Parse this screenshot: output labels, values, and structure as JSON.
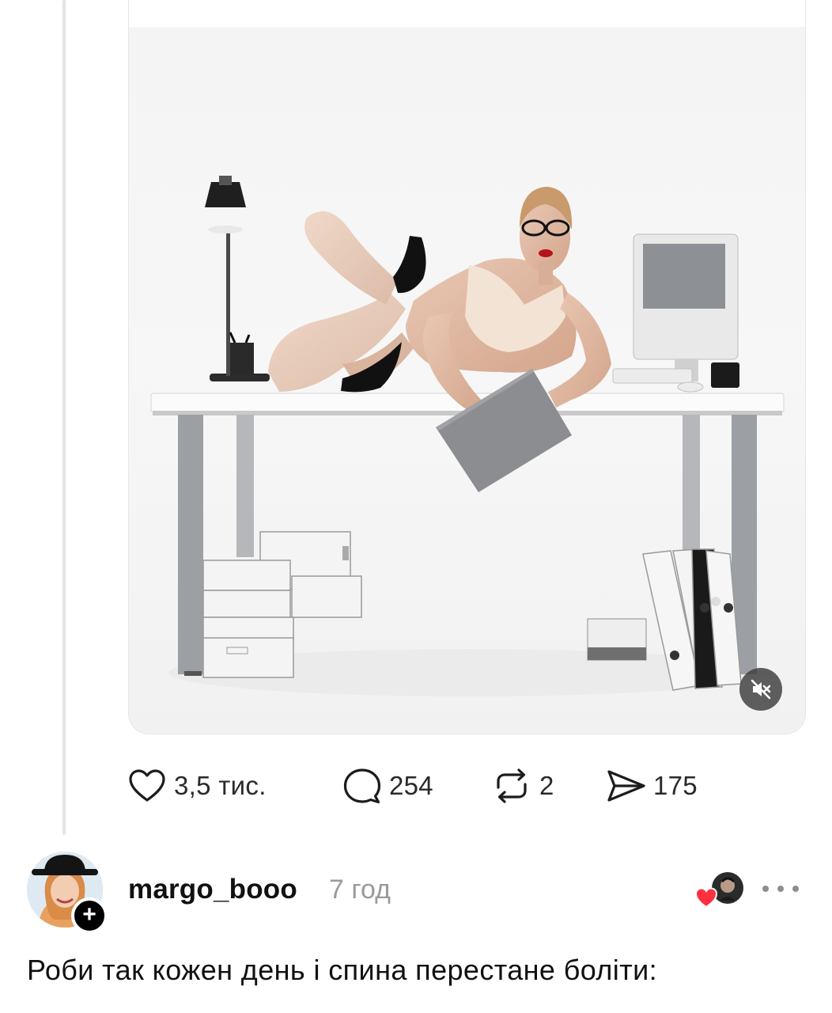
{
  "post": {
    "media": {
      "mute_icon": "speaker-muted-icon"
    },
    "actions": {
      "like": {
        "icon": "heart-icon",
        "count": "3,5 тис."
      },
      "comment": {
        "icon": "speech-bubble-icon",
        "count": "254"
      },
      "repost": {
        "icon": "repost-icon",
        "count": "2"
      },
      "share": {
        "icon": "send-icon",
        "count": "175"
      }
    }
  },
  "reply": {
    "username": "margo_booo",
    "time": "7 год",
    "follow_icon": "plus-icon",
    "liked_by_author_icon": "heart-icon",
    "more_icon": "ellipsis-icon",
    "text": "Роби так кожен день і спина перестане боліти:"
  },
  "colors": {
    "text": "#111111",
    "muted": "#9a9a9a",
    "thread_line": "#e4e4e4",
    "like_red": "#ff3040"
  }
}
